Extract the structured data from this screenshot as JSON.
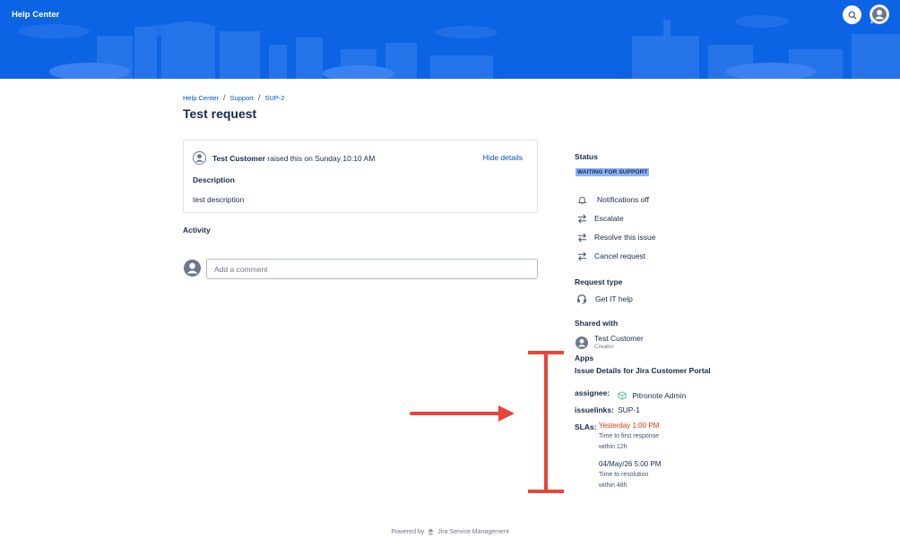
{
  "header": {
    "brand": "Help Center",
    "avatar_count": "1"
  },
  "breadcrumb": [
    "Help Center",
    "Support",
    "SUP-2"
  ],
  "page_title": "Test request",
  "request": {
    "reporter": "Test Customer",
    "raised_text": "raised this on Sunday 10:10 AM",
    "hide_details": "Hide details",
    "description_heading": "Description",
    "description": "test description"
  },
  "activity": {
    "heading": "Activity",
    "comment_placeholder": "Add a comment"
  },
  "sidebar": {
    "status_heading": "Status",
    "status_value": "WAITING FOR SUPPORT",
    "actions": [
      {
        "label": "Notifications off",
        "icon": "bell-icon"
      },
      {
        "label": "Escalate",
        "icon": "transition-icon"
      },
      {
        "label": "Resolve this issue",
        "icon": "transition-icon"
      },
      {
        "label": "Cancel request",
        "icon": "transition-icon"
      }
    ],
    "request_type_heading": "Request type",
    "request_type": "Get IT help",
    "shared_heading": "Shared with",
    "shared_name": "Test Customer",
    "shared_role": "Creator",
    "apps_heading": "Apps",
    "app_title": "Issue Details for Jira Customer Portal",
    "assignee_label": "assignee:",
    "assignee_value": "Pitronote Admin",
    "issuelinks_label": "issuelinks:",
    "issuelinks_value": "SUP-1",
    "slas_label": "SLAs:",
    "slas": [
      {
        "time": "Yesterday 1:00 PM",
        "metric": "Time to first response",
        "target": "within 12h",
        "breached": true
      },
      {
        "time": "04/May/26 5:00 PM",
        "metric": "Time to resolution",
        "target": "within 48h",
        "breached": false
      }
    ]
  },
  "footer": {
    "powered_by": "Powered by",
    "product": "Jira Service Management"
  },
  "colors": {
    "banner": "#0c63e4",
    "link": "#0052cc",
    "lozenge": "#8ab4f8",
    "breached": "#de350b",
    "annotation": "#e8453c"
  }
}
